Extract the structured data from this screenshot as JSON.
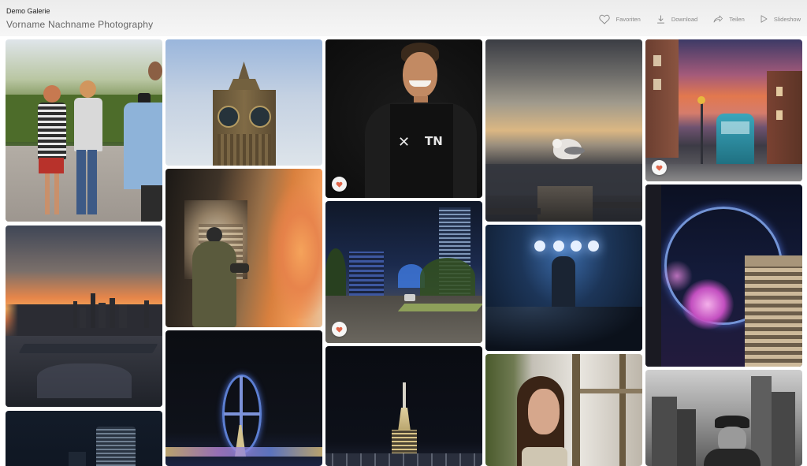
{
  "header": {
    "demo_label": "Demo Galerie",
    "gallery_title": "Vorname Nachname Photography"
  },
  "toolbar": {
    "favorites_label": "Favoriten",
    "download_label": "Download",
    "share_label": "Teilen",
    "slideshow_label": "Slideshow"
  },
  "icons": {
    "favorites": "heart-outline-icon",
    "download": "download-icon",
    "share": "share-arrow-icon",
    "slideshow": "play-icon",
    "favorite_badge": "heart-filled-icon"
  },
  "colors": {
    "favorite_heart": "#e0664b",
    "toolbar_text": "#888888",
    "header_background": "#eeeeee"
  },
  "photos": [
    {
      "subject": "two women posing with photographer",
      "favorited": false
    },
    {
      "subject": "big ben clock tower",
      "favorited": false
    },
    {
      "subject": "portrait smiling man",
      "favorited": true
    },
    {
      "subject": "seagull at sunset",
      "favorited": false
    },
    {
      "subject": "frankfurt tram street",
      "favorited": true
    },
    {
      "subject": "skyline sunset river",
      "favorited": false
    },
    {
      "subject": "woman at shop window night",
      "favorited": false
    },
    {
      "subject": "city night street",
      "favorited": true
    },
    {
      "subject": "concert stage lights",
      "favorited": false
    },
    {
      "subject": "ferris wheel fireworks",
      "favorited": false
    },
    {
      "subject": "ferris wheel night",
      "favorited": false
    },
    {
      "subject": "empire state building night",
      "favorited": false
    },
    {
      "subject": "woman portrait window",
      "favorited": false
    },
    {
      "subject": "man with cap black and white",
      "favorited": false
    },
    {
      "subject": "skyscraper night",
      "favorited": false
    }
  ]
}
